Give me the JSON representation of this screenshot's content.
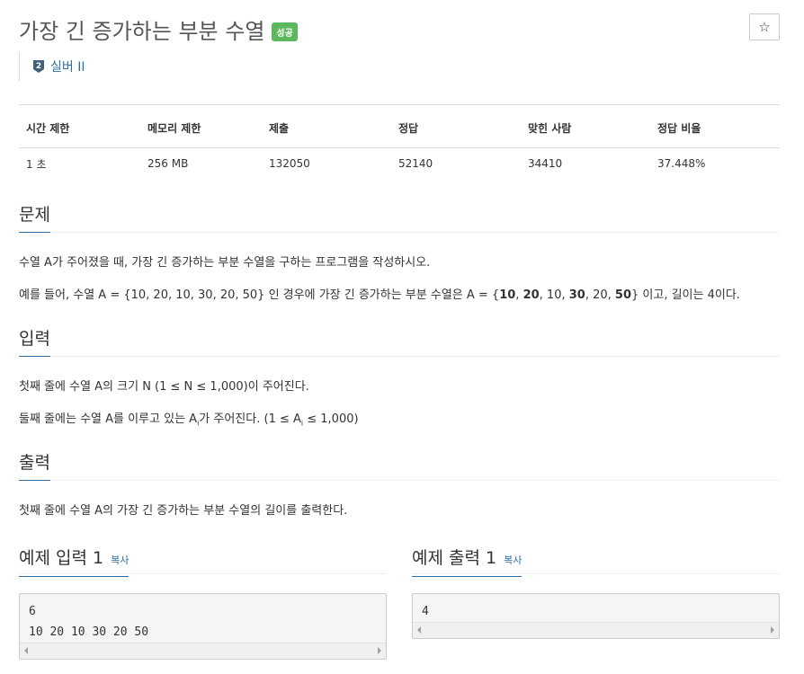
{
  "problem": {
    "title": "가장 긴 증가하는 부분 수열",
    "status_badge": "성공",
    "tier_number": "2",
    "tier_label": "실버 II",
    "star_glyph": "☆"
  },
  "info_table": {
    "headers": [
      "시간 제한",
      "메모리 제한",
      "제출",
      "정답",
      "맞힌 사람",
      "정답 비율"
    ],
    "values": [
      "1 초",
      "256 MB",
      "132050",
      "52140",
      "34410",
      "37.448%"
    ]
  },
  "sections": {
    "problem": {
      "title": "문제",
      "line1": "수열 A가 주어졌을 때, 가장 긴 증가하는 부분 수열을 구하는 프로그램을 작성하시오.",
      "line2_a": "예를 들어, 수열 A = {10, 20, 10, 30, 20, 50} 인 경우에 가장 긴 증가하는 부분 수열은 A = {",
      "line2_b1": "10",
      "line2_sep1": ", ",
      "line2_b2": "20",
      "line2_mid": ", 10, ",
      "line2_b3": "30",
      "line2_mid2": ", 20, ",
      "line2_b4": "50",
      "line2_end": "} 이고, 길이는 4이다."
    },
    "input": {
      "title": "입력",
      "line1": "첫째 줄에 수열 A의 크기 N (1 ≤ N ≤ 1,000)이 주어진다.",
      "line2_a": "둘째 줄에는 수열 A를 이루고 있는 A",
      "line2_sub": "i",
      "line2_b": "가 주어진다. (1 ≤ A",
      "line2_sub2": "i",
      "line2_c": " ≤ 1,000)"
    },
    "output": {
      "title": "출력",
      "line1": "첫째 줄에 수열 A의 가장 긴 증가하는 부분 수열의 길이를 출력한다."
    }
  },
  "samples": {
    "input": {
      "title": "예제 입력 1",
      "copy": "복사",
      "lines": [
        "6",
        "10 20 10 30 20 50"
      ]
    },
    "output": {
      "title": "예제 출력 1",
      "copy": "복사",
      "lines": [
        "4"
      ]
    }
  },
  "colors": {
    "badge": "#5cb85c",
    "link": "#2d6da8",
    "tier_icon": "#435f7a"
  }
}
